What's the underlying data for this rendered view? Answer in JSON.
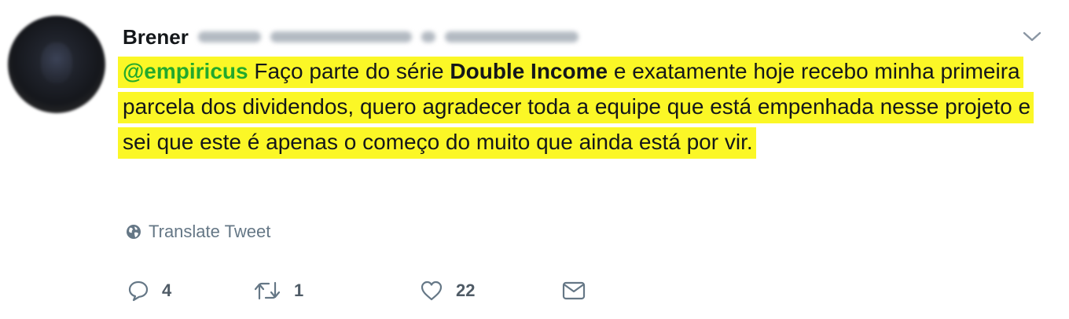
{
  "tweet": {
    "author_name": "Brener",
    "text": {
      "mention": "@empiricus",
      "part1": " Faço parte do série ",
      "bold": "Double Income",
      "part2": " e exatamente hoje recebo minha primeira parcela dos dividendos, quero agradecer toda a equipe que está empenhada nesse projeto e sei que este é apenas o começo do muito que ainda está por vir."
    },
    "highlight_color": "#fbf726",
    "mention_color": "#23a92c",
    "translate_label": "Translate Tweet",
    "actions": {
      "reply_count": "4",
      "retweet_count": "1",
      "like_count": "22"
    }
  },
  "icons": {
    "menu": "chevron-down-icon",
    "translate": "globe-icon",
    "reply": "reply-icon",
    "retweet": "retweet-icon",
    "like": "heart-icon",
    "dm": "envelope-icon"
  }
}
